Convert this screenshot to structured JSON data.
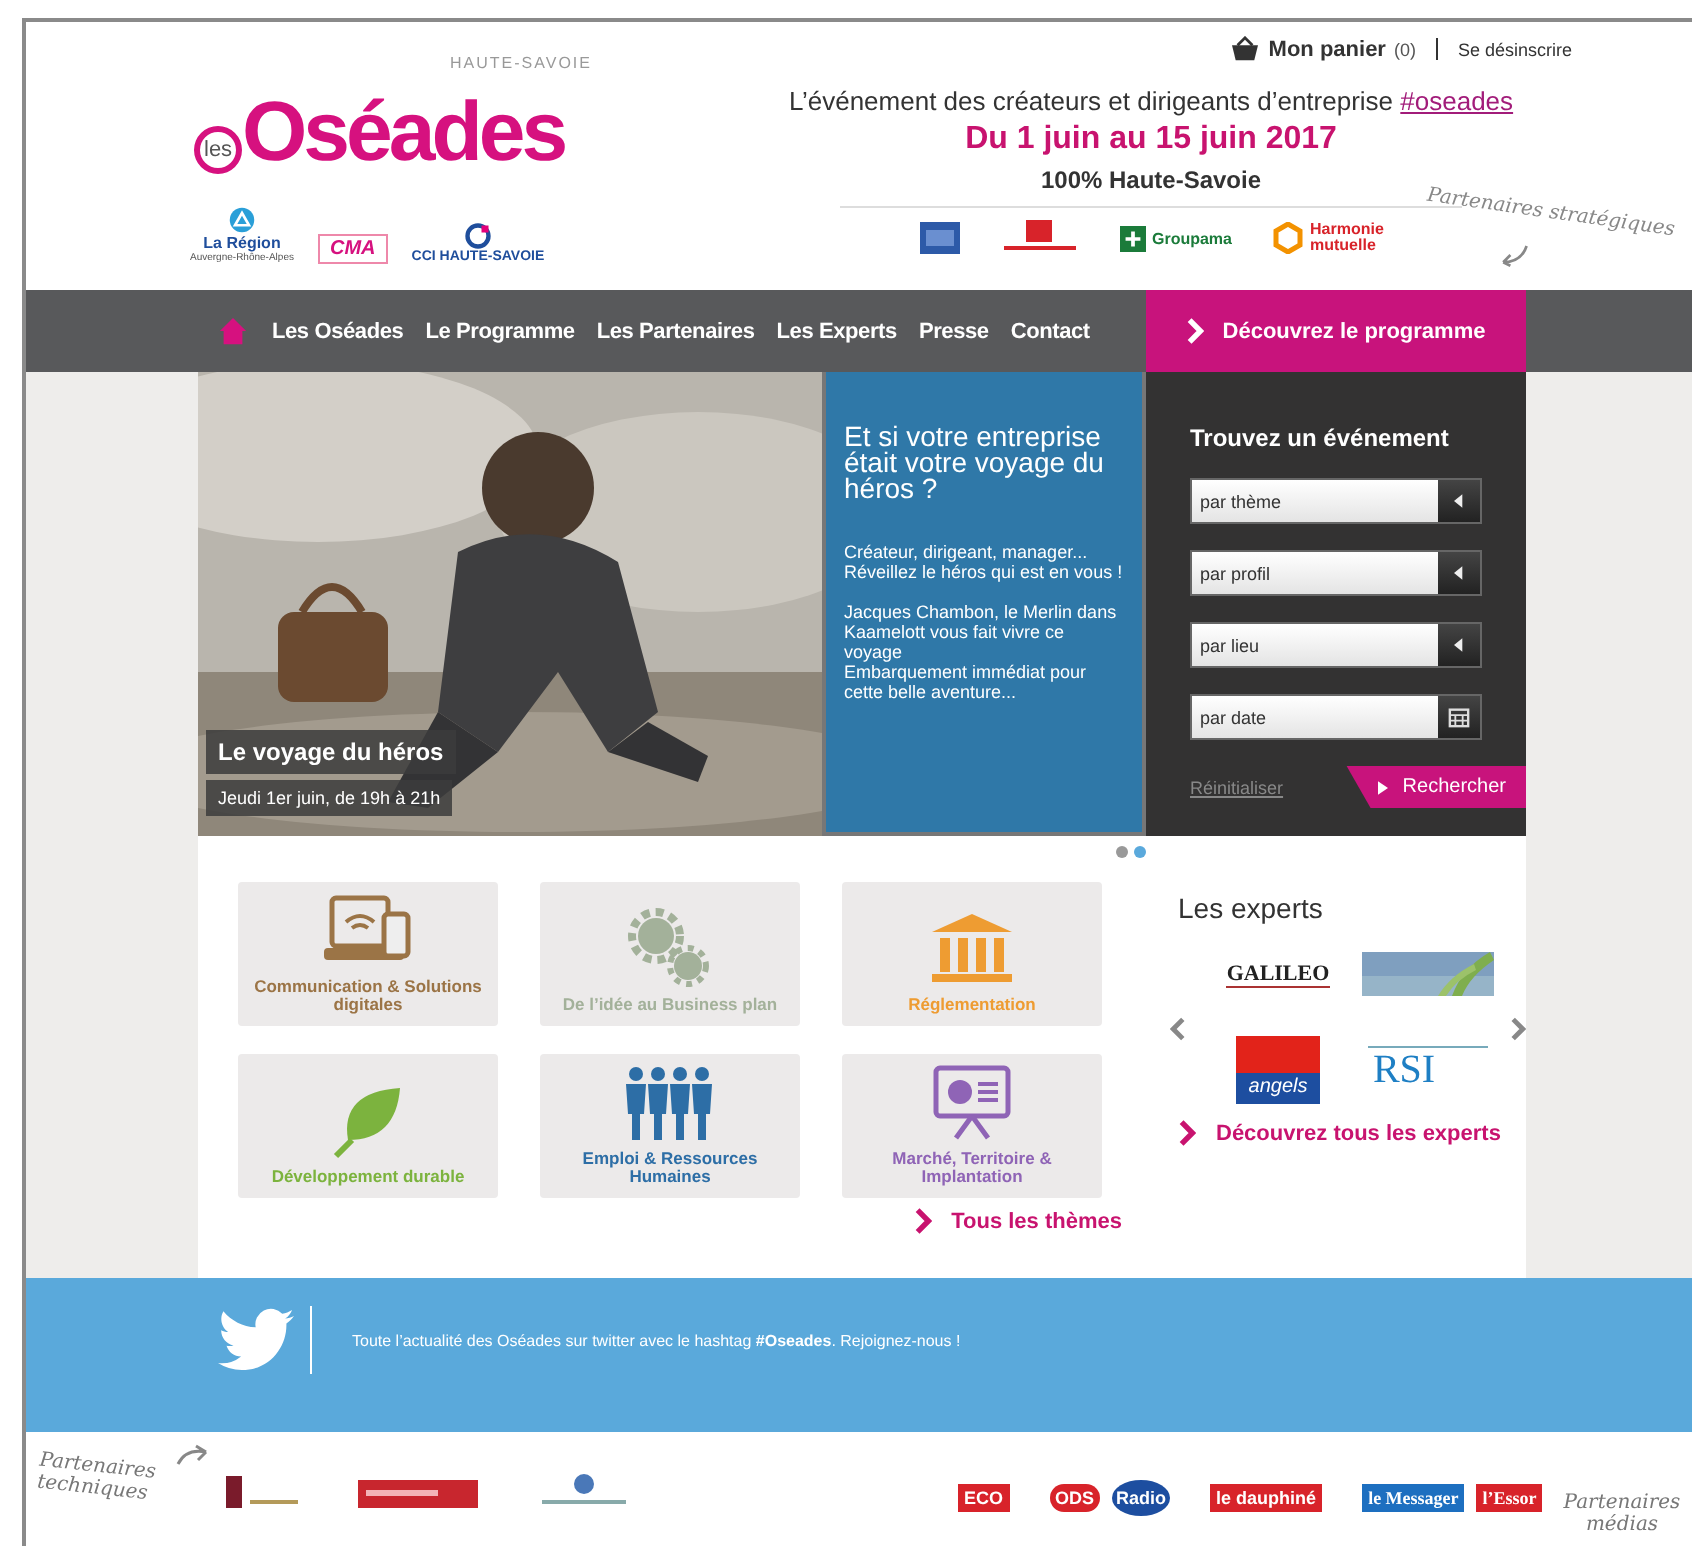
{
  "header": {
    "logo": {
      "prefix": "les",
      "name": "Oséades",
      "stamp": "HAUTE-SAVOIE"
    },
    "institutions": [
      {
        "kind": "region",
        "name": "La Région",
        "sub": "Auvergne-Rhône-Alpes"
      },
      {
        "kind": "cma",
        "name": "CMA"
      },
      {
        "kind": "cci",
        "name": "CCI HAUTE-SAVOIE"
      }
    ],
    "cart": {
      "label": "Mon panier",
      "count": "(0)"
    },
    "unsubscribe": "Se désinscrire",
    "tagline": "L’événement des créateurs et dirigeants d’entreprise",
    "hashtag": "#oseades",
    "dates": "Du 1 juin au 15 juin 2017",
    "region": "100% Haute-Savoie",
    "partners_label": "Partenaires stratégiques",
    "partners": [
      {
        "kind": "bank"
      },
      {
        "kind": "caisse"
      },
      {
        "kind": "groupama",
        "name": "Groupama"
      },
      {
        "kind": "harmonie",
        "name": "Harmonie mutuelle"
      }
    ]
  },
  "nav": {
    "items": [
      {
        "label": "Les Oséades",
        "selected": false
      },
      {
        "label": "Le Programme",
        "selected": false
      },
      {
        "label": "Les Partenaires",
        "selected": false
      },
      {
        "label": "Les Experts",
        "selected": false
      },
      {
        "label": "Presse",
        "selected": false
      },
      {
        "label": "Contact",
        "selected": false
      }
    ],
    "cta": "Découvrez le programme"
  },
  "hero": {
    "caption": "Le voyage du héros",
    "date": "Jeudi 1er juin, de 19h à 21h",
    "title": "Et si votre entreprise était votre voyage du héros ?",
    "paragraphs": [
      "Créateur, dirigeant, manager... Réveillez le héros qui est en vous !",
      "Jacques Chambon, le Merlin dans Kaamelott vous fait vivre ce voyage",
      "Embarquement immédiat pour cette belle aventure..."
    ],
    "dots": [
      {
        "selected": false
      },
      {
        "selected": true
      }
    ]
  },
  "search": {
    "title": "Trouvez un événement",
    "fields": [
      {
        "kind": "select",
        "placeholder": "par thème"
      },
      {
        "kind": "select",
        "placeholder": "par profil"
      },
      {
        "kind": "select",
        "placeholder": "par lieu"
      },
      {
        "kind": "date",
        "placeholder": "par date"
      }
    ],
    "reset": "Réinitialiser",
    "submit": "Rechercher"
  },
  "themes": {
    "items": [
      {
        "kind": "devices",
        "label": "Communication & Solutions digitales",
        "color": "#9b7446"
      },
      {
        "kind": "gears",
        "label": "De l’idée au Business plan",
        "color": "#a3b19a"
      },
      {
        "kind": "columns",
        "label": "Réglementation",
        "color": "#ee9c32"
      },
      {
        "kind": "leaf",
        "label": "Développement durable",
        "color": "#7cb33e"
      },
      {
        "kind": "people",
        "label": "Emploi & Ressources Humaines",
        "color": "#2d6ea6"
      },
      {
        "kind": "presentation",
        "label": "Marché, Territoire & Implantation",
        "color": "#8f64b6"
      }
    ],
    "more": "Tous les thèmes"
  },
  "experts": {
    "title": "Les experts",
    "logos": [
      {
        "kind": "galileo",
        "text": "GALILEO"
      },
      {
        "kind": "picture"
      },
      {
        "kind": "angels",
        "text": "angels"
      },
      {
        "kind": "rsi",
        "text": "RSI"
      }
    ],
    "more": "Découvrez tous les experts"
  },
  "twitter": {
    "text": "Toute l’actualité des Oséades sur twitter avec le hashtag **#Oseades**. Rejoignez-nous !"
  },
  "footer": {
    "tech_label": "Partenaires techniques",
    "tech": [
      {
        "kind": "building"
      },
      {
        "kind": "banner"
      },
      {
        "kind": "chamber"
      }
    ],
    "media": [
      {
        "kind": "eco",
        "text": "ECO"
      },
      {
        "kind": "ods",
        "text": "ODS"
      },
      {
        "kind": "radio",
        "text": "Radio"
      },
      {
        "kind": "dauphine",
        "text": "le dauphiné"
      },
      {
        "kind": "messager",
        "text": "le Messager"
      },
      {
        "kind": "essor",
        "text": "l’Essor"
      }
    ],
    "media_label": "Partenaires médias"
  }
}
